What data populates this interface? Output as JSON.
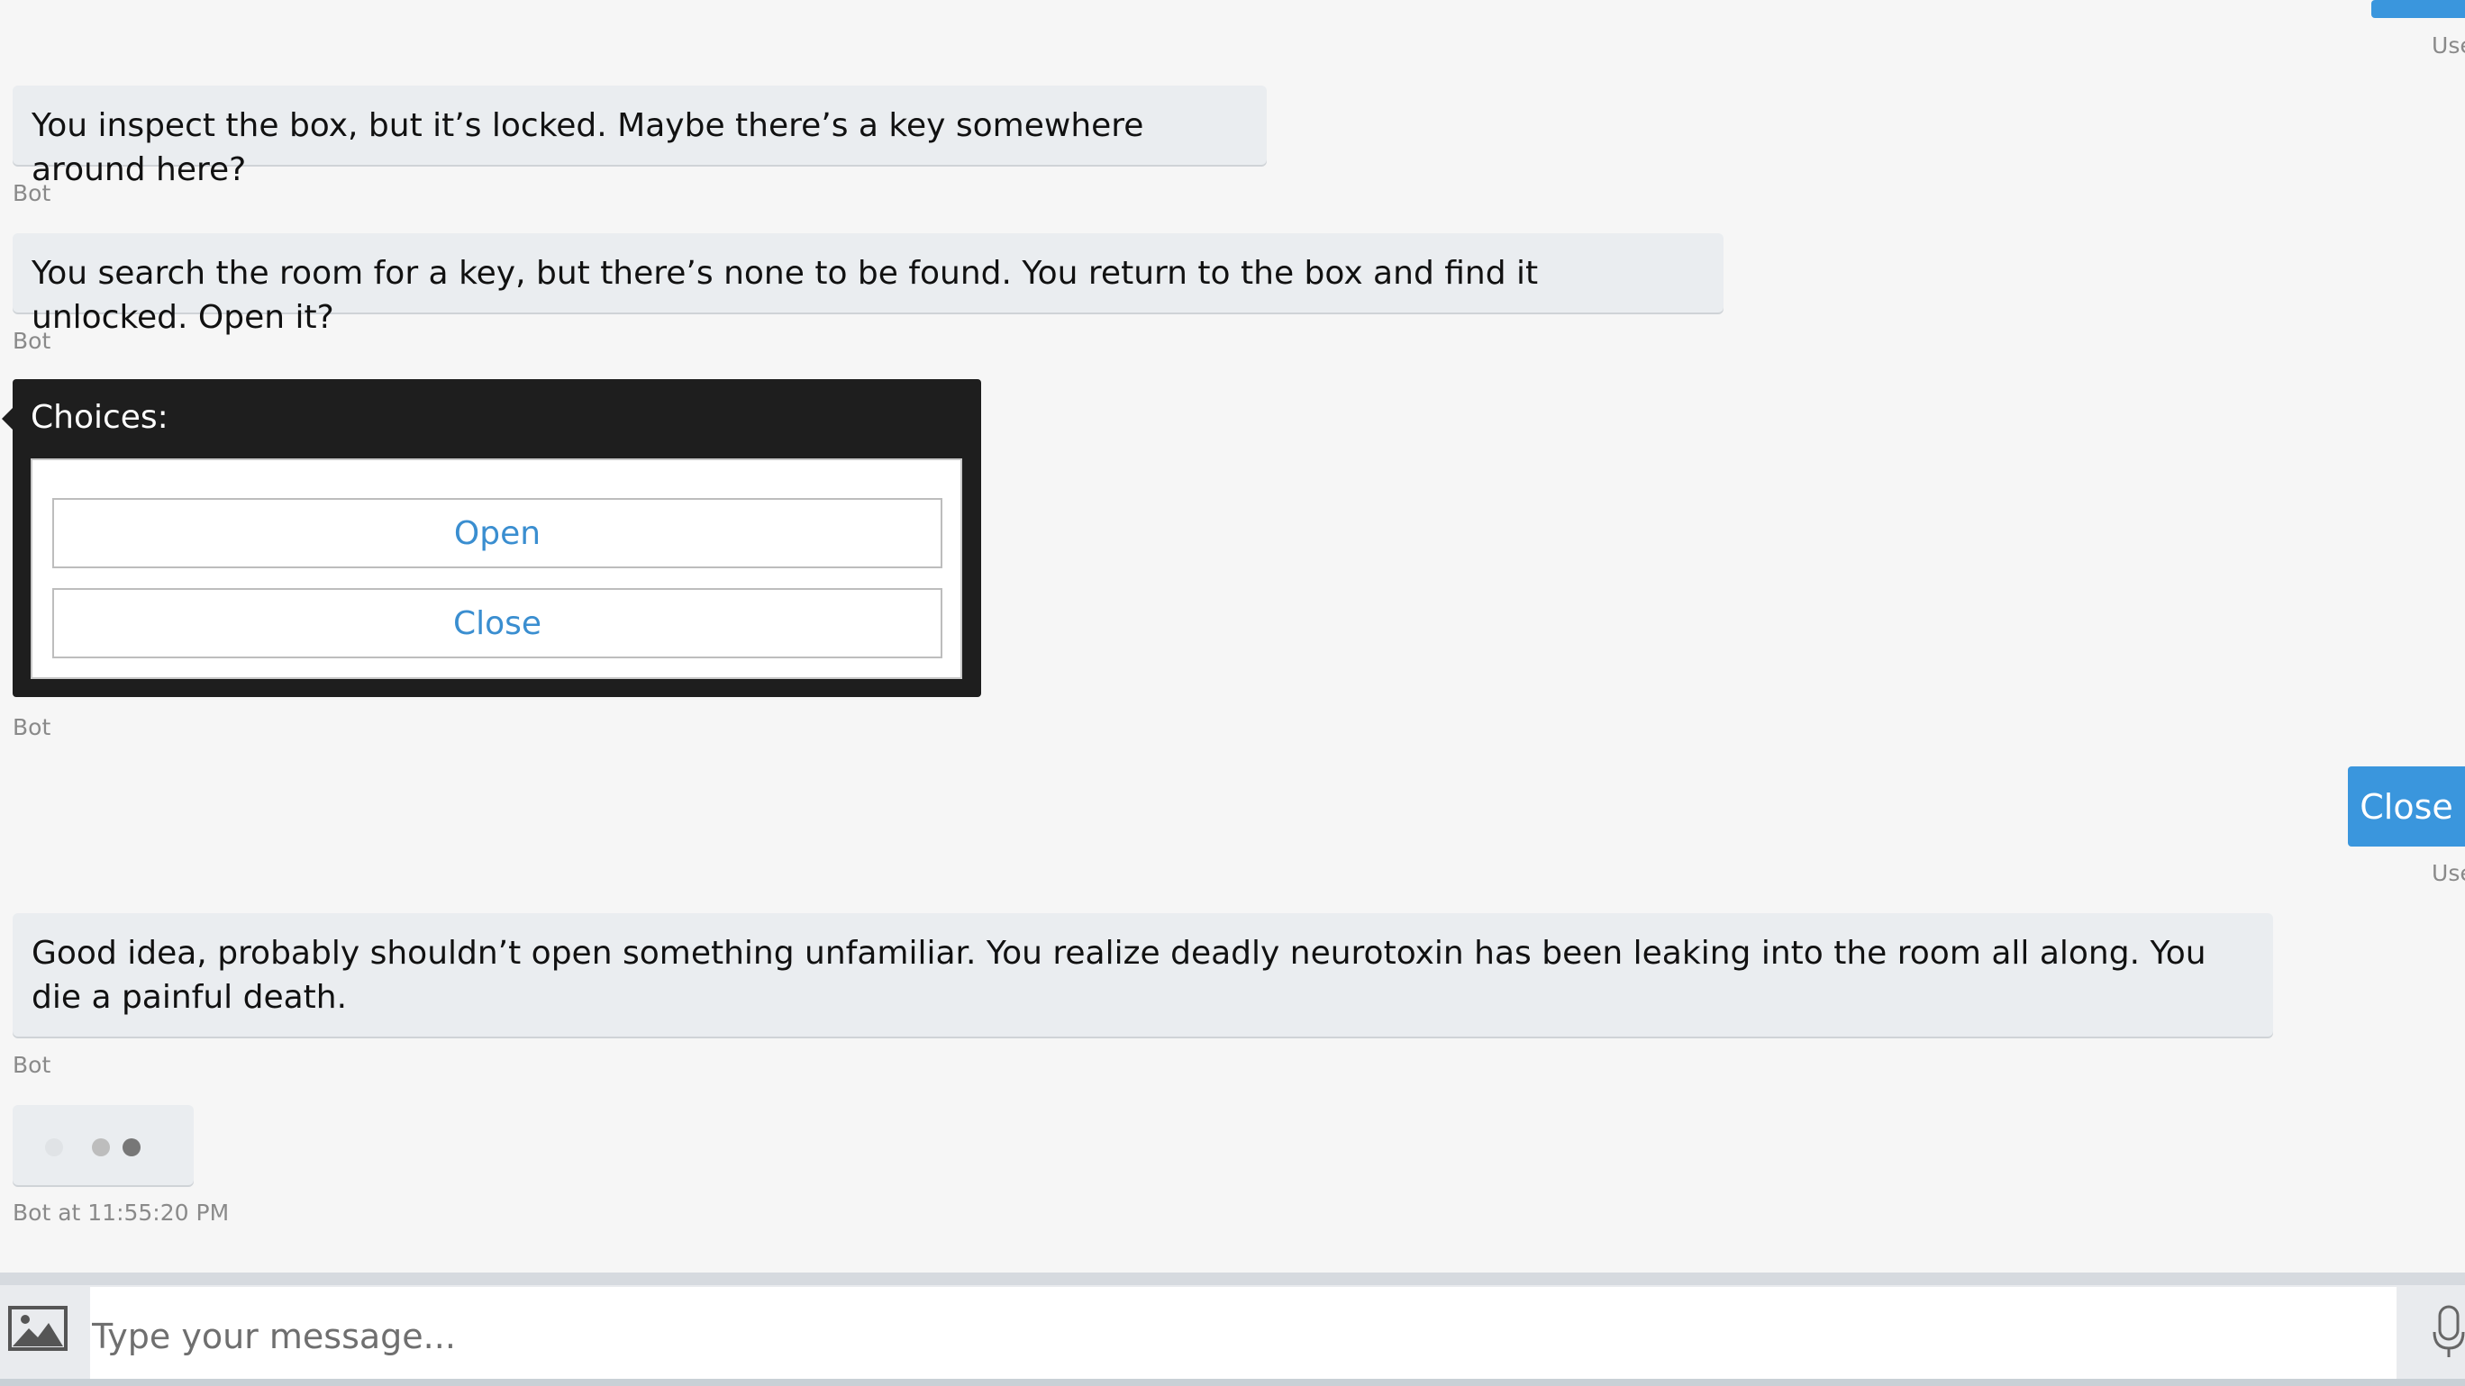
{
  "messages": {
    "top_user_label": "User",
    "bot_msg_1": "You inspect the box, but it’s locked. Maybe there’s a key somewhere around here?",
    "bot_label_1": "Bot",
    "bot_msg_2": "You search the room for a key, but there’s none to be found. You return to the box and find it unlocked. Open it?",
    "bot_label_2": "Bot",
    "choices": {
      "title": "Choices:",
      "options": [
        "Open",
        "Close"
      ]
    },
    "bot_label_3": "Bot",
    "user_msg": "Close",
    "user_label": "User",
    "bot_msg_3": "Good idea, probably shouldn’t open something unfamiliar. You realize deadly neurotoxin has been leaking into the room all along. You die a painful death.",
    "bot_label_4": "Bot",
    "typing_label": "Bot at 11:55:20 PM"
  },
  "input": {
    "placeholder": "Type your message..."
  },
  "icons": {
    "upload": "image-icon",
    "mic": "microphone-icon"
  },
  "colors": {
    "user_bubble": "#3a96dd",
    "bot_bubble": "#eaedf0",
    "choice_text": "#3a8ed0",
    "card_bg": "#1e1e1e",
    "background": "#f6f6f6"
  }
}
